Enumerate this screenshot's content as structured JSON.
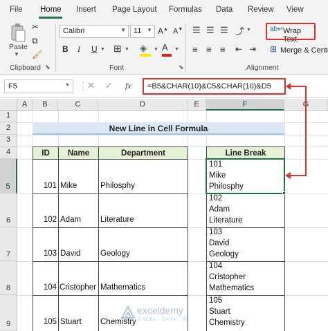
{
  "tabs": [
    "File",
    "Home",
    "Insert",
    "Page Layout",
    "Formulas",
    "Data",
    "Review",
    "View"
  ],
  "ribbon": {
    "clipboard": {
      "paste_label": "Paste",
      "group_label": "Clipboard"
    },
    "font": {
      "family": "Calibri",
      "size": "11",
      "group_label": "Font"
    },
    "alignment": {
      "wrap_text_label": "Wrap Text",
      "merge_center_label": "Merge & Center",
      "group_label": "Alignment"
    }
  },
  "formula_bar": {
    "name_box": "F5",
    "formula": "=B5&CHAR(10)&C5&CHAR(10)&D5"
  },
  "sheet": {
    "columns": [
      "A",
      "B",
      "C",
      "D",
      "E",
      "F",
      "G"
    ],
    "rows": [
      "1",
      "2",
      "3",
      "4",
      "5",
      "6",
      "7",
      "8",
      "9"
    ],
    "title": "New Line in Cell Formula",
    "headers": {
      "id": "ID",
      "name": "Name",
      "department": "Department",
      "line_break": "Line Break"
    },
    "records": [
      {
        "id": "101",
        "name": "Mike",
        "department": "Philosphy",
        "line1": "101",
        "line2": "Mike",
        "line3": "Philosphy"
      },
      {
        "id": "102",
        "name": "Adam",
        "department": "Literature",
        "line1": "102",
        "line2": "Adam",
        "line3": "Literature"
      },
      {
        "id": "103",
        "name": "David",
        "department": "Geology",
        "line1": "103",
        "line2": "David",
        "line3": "Geology"
      },
      {
        "id": "104",
        "name": "Cristopher",
        "department": "Mathematics",
        "line1": "104",
        "line2": "Cristopher",
        "line3": "Mathematics"
      },
      {
        "id": "105",
        "name": "Stuart",
        "department": "Chemistry",
        "line1": "105",
        "line2": "Stuart",
        "line3": "Chemistry"
      }
    ]
  },
  "watermark": {
    "brand": "exceldemy",
    "tagline": "EXCEL · DATA · BI"
  },
  "colors": {
    "accent": "#217346",
    "highlight": "#d9342b",
    "title_fill": "#dce9f5",
    "header_fill": "#e4f1d7"
  }
}
